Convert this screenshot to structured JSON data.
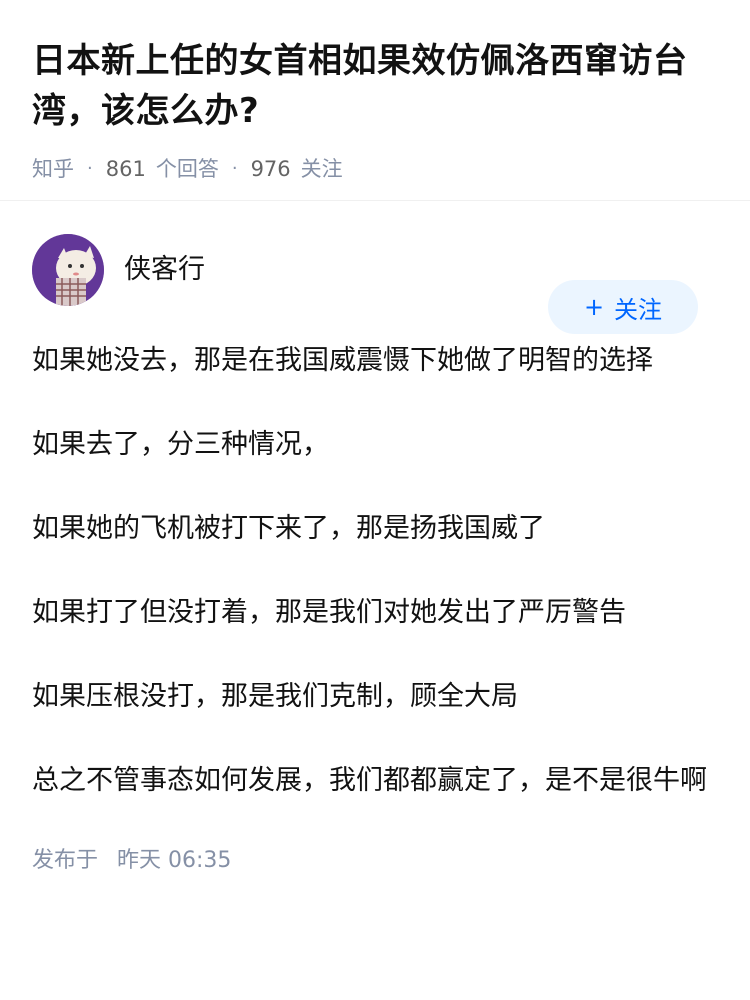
{
  "question": {
    "title": "日本新上任的女首相如果效仿佩洛西窜访台湾，该怎么办?",
    "source": "知乎",
    "answers_count": "861",
    "answers_label": "个回答",
    "followers_count": "976",
    "followers_label": "关注"
  },
  "answer": {
    "author_name": "侠客行",
    "follow_plus": "+",
    "follow_label": "关注",
    "paragraphs": [
      "如果她没去，那是在我国威震慑下她做了明智的选择",
      "如果去了，分三种情况，",
      "如果她的飞机被打下来了，那是扬我国威了",
      "如果打了但没打着，那是我们对她发出了严厉警告",
      "如果压根没打，那是我们克制，顾全大局",
      "总之不管事态如何发展，我们都都赢定了，是不是很牛啊"
    ],
    "publish_label": "发布于",
    "publish_time": "昨天 06:35"
  },
  "colors": {
    "accent": "#0066ff",
    "follow_bg": "#ebf5ff",
    "meta_gray": "#8590a6",
    "avatar_bg": "#6b3fa0"
  }
}
